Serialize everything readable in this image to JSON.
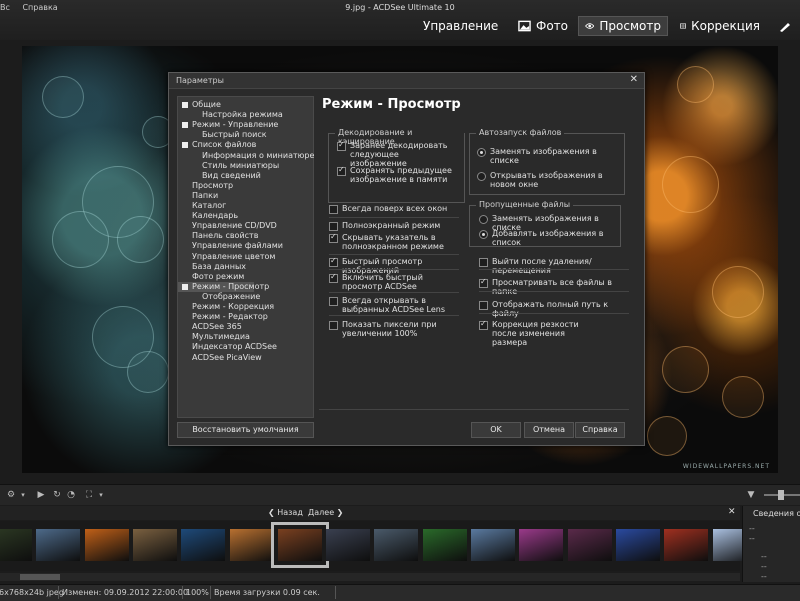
{
  "menu": [
    "Вс",
    "Справка"
  ],
  "window_title": "9.jpg - ACDSee Ultimate 10",
  "modes": [
    {
      "label": "Управление",
      "icon": "grid-icon"
    },
    {
      "label": "Фото",
      "icon": "photo-icon"
    },
    {
      "label": "Просмотр",
      "icon": "eye-icon",
      "active": true
    },
    {
      "label": "Коррекция",
      "icon": "develop-icon"
    }
  ],
  "watermark": "WIDEWALLPAPERS.NET",
  "dialog": {
    "title": "Параметры",
    "section_title": "Режим - Просмотр",
    "tree": [
      {
        "label": "Общие",
        "level": 0,
        "expander": true
      },
      {
        "label": "Настройка режима",
        "level": 1
      },
      {
        "label": "Режим - Управление",
        "level": 0,
        "expander": true
      },
      {
        "label": "Быстрый поиск",
        "level": 1
      },
      {
        "label": "Список файлов",
        "level": 0,
        "expander": true
      },
      {
        "label": "Информация о миниатюре",
        "level": 1
      },
      {
        "label": "Стиль миниатюры",
        "level": 1
      },
      {
        "label": "Вид сведений",
        "level": 1
      },
      {
        "label": "Просмотр",
        "level": 0
      },
      {
        "label": "Папки",
        "level": 0
      },
      {
        "label": "Каталог",
        "level": 0
      },
      {
        "label": "Календарь",
        "level": 0
      },
      {
        "label": "Управление CD/DVD",
        "level": 0
      },
      {
        "label": "Панель свойств",
        "level": 0
      },
      {
        "label": "Управление файлами",
        "level": 0
      },
      {
        "label": "Управление цветом",
        "level": 0
      },
      {
        "label": "База данных",
        "level": 0
      },
      {
        "label": "Фото режим",
        "level": 0
      },
      {
        "label": "Режим - Просмотр",
        "level": 0,
        "expander": true,
        "selected": true
      },
      {
        "label": "Отображение",
        "level": 1
      },
      {
        "label": "Режим - Коррекция",
        "level": 0
      },
      {
        "label": "Режим - Редактор",
        "level": 0
      },
      {
        "label": "ACDSee 365",
        "level": 0
      },
      {
        "label": "Мультимедиа",
        "level": 0
      },
      {
        "label": "Индексатор ACDSee",
        "level": 0
      },
      {
        "label": "ACDSee PicaView",
        "level": 0
      }
    ],
    "decode_group": {
      "title": "Декодирование и кэширование",
      "options": [
        {
          "label": "Заранее декодировать следующее изображение",
          "checked": true
        },
        {
          "label": "Сохранять предыдущее изображение в памяти",
          "checked": true
        }
      ]
    },
    "autostart_group": {
      "title": "Автозапуск файлов",
      "options": [
        {
          "label": "Заменять изображения в списке",
          "checked": true
        },
        {
          "label": "Открывать изображения в новом окне",
          "checked": false
        }
      ]
    },
    "skipped_group": {
      "title": "Пропущенные файлы",
      "options": [
        {
          "label": "Заменять изображения в списке",
          "checked": false
        },
        {
          "label": "Добавлять изображения в список",
          "checked": true
        }
      ]
    },
    "left_options": [
      {
        "label": "Всегда поверх всех окон",
        "checked": false
      },
      {
        "label": "Полноэкранный режим",
        "checked": false
      },
      {
        "label": "Скрывать указатель в полноэкранном режиме",
        "checked": true
      },
      {
        "label": "Быстрый просмотр изображений",
        "checked": true
      },
      {
        "label": "Включить быстрый просмотр ACDSee",
        "checked": true
      },
      {
        "label": "Всегда открывать в выбранных ACDSee Lens",
        "checked": false
      },
      {
        "label": "Показать пиксели при увеличении 100%",
        "checked": false
      }
    ],
    "right_options": [
      {
        "label": "Выйти после удаления/перемещения",
        "checked": false
      },
      {
        "label": "Просматривать все файлы в папке",
        "checked": true
      },
      {
        "label": "Отображать полный путь к файлу",
        "checked": false
      },
      {
        "label": "Коррекция резкости после изменения размера",
        "checked": true
      }
    ],
    "buttons": {
      "restore": "Восстановить умолчания",
      "ok": "OK",
      "cancel": "Отмена",
      "help": "Справка"
    }
  },
  "filmstrip": {
    "back": "Назад",
    "forward": "Далее",
    "thumbnails": [
      "#2d3a24",
      "#4d6a8a",
      "#c06018",
      "#7a6040",
      "#1e4a7a",
      "#b87030",
      "#7a4020",
      "#3a4050",
      "#4a5a6a",
      "#2a6a2a",
      "#5a7aa0",
      "#9a3a8a",
      "#5a2a4a",
      "#2a4aa0",
      "#a03020",
      "#aac0e0"
    ],
    "selected_index": 6
  },
  "info_panel": {
    "title": "Сведения о п",
    "rows": [
      "--",
      "--",
      "--",
      "--",
      "--",
      "--"
    ]
  },
  "status": {
    "image": "6x768x24b jpeg",
    "modified": "Изменен: 09.09.2012 22:00:00",
    "zoom": "100%",
    "load_time": "Время загрузки 0.09 сек."
  }
}
